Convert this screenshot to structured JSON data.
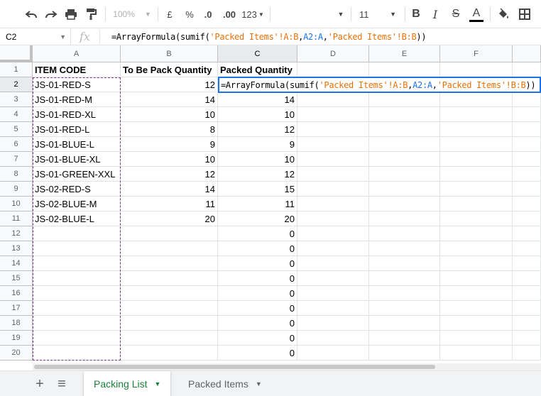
{
  "toolbar": {
    "zoom": "100%",
    "currency_symbol": "£",
    "percent_symbol": "%",
    "decrease_decimals": ".0",
    "increase_decimals": ".00",
    "number_format": "123",
    "font_size": "11",
    "icons": [
      "undo-icon",
      "redo-icon",
      "print-icon",
      "paint-format-icon",
      "bold-icon",
      "italic-icon",
      "strikethrough-icon",
      "text-color-icon",
      "fill-color-icon",
      "borders-icon"
    ]
  },
  "formula_bar": {
    "cell_ref": "C2",
    "fx": "fx",
    "formula": "=ArrayFormula(sumif('Packed Items'!A:B,A2:A,'Packed Items'!B:B))"
  },
  "grid": {
    "columns": [
      "A",
      "B",
      "C",
      "D",
      "E",
      "F"
    ],
    "selected_column": "C",
    "selected_row": "2",
    "row_numbers": [
      "1",
      "2",
      "3",
      "4",
      "5",
      "6",
      "7",
      "8",
      "9",
      "10",
      "11",
      "12",
      "13",
      "14",
      "15",
      "16",
      "17",
      "18",
      "19",
      "20"
    ],
    "headers": [
      "ITEM CODE",
      "To Be Pack Quantity",
      "Packed Quantity"
    ],
    "rows": [
      {
        "code": "JS-01-RED-S",
        "to_pack": "12",
        "packed": ""
      },
      {
        "code": "JS-01-RED-M",
        "to_pack": "14",
        "packed": "14"
      },
      {
        "code": "JS-01-RED-XL",
        "to_pack": "10",
        "packed": "10"
      },
      {
        "code": "JS-01-RED-L",
        "to_pack": "8",
        "packed": "12"
      },
      {
        "code": "JS-01-BLUE-L",
        "to_pack": "9",
        "packed": "9"
      },
      {
        "code": "JS-01-BLUE-XL",
        "to_pack": "10",
        "packed": "10"
      },
      {
        "code": "JS-01-GREEN-XXL",
        "to_pack": "12",
        "packed": "12"
      },
      {
        "code": "JS-02-RED-S",
        "to_pack": "14",
        "packed": "15"
      },
      {
        "code": "JS-02-BLUE-M",
        "to_pack": "11",
        "packed": "11"
      },
      {
        "code": "JS-02-BLUE-L",
        "to_pack": "20",
        "packed": "20"
      },
      {
        "code": "",
        "to_pack": "",
        "packed": "0"
      },
      {
        "code": "",
        "to_pack": "",
        "packed": "0"
      },
      {
        "code": "",
        "to_pack": "",
        "packed": "0"
      },
      {
        "code": "",
        "to_pack": "",
        "packed": "0"
      },
      {
        "code": "",
        "to_pack": "",
        "packed": "0"
      },
      {
        "code": "",
        "to_pack": "",
        "packed": "0"
      },
      {
        "code": "",
        "to_pack": "",
        "packed": "0"
      },
      {
        "code": "",
        "to_pack": "",
        "packed": "0"
      },
      {
        "code": "",
        "to_pack": "",
        "packed": "0"
      }
    ],
    "active_cell_formula": {
      "p1": "=ArrayFormula(sumif(",
      "p2": "'Packed Items'!A:B",
      "p3": ",",
      "p4": "A2:A",
      "p5": ",",
      "p6": "'Packed Items'!B:B",
      "p7": "))"
    }
  },
  "sheets": {
    "add_icon": "+",
    "list_icon": "≡",
    "tabs": [
      {
        "label": "Packing List",
        "active": true
      },
      {
        "label": "Packed Items",
        "active": false
      }
    ]
  },
  "colors": {
    "active_tab": "#188038",
    "selection": "#1a73e8",
    "copy_border": "#7e3794",
    "formula_string": "#e8710a"
  }
}
